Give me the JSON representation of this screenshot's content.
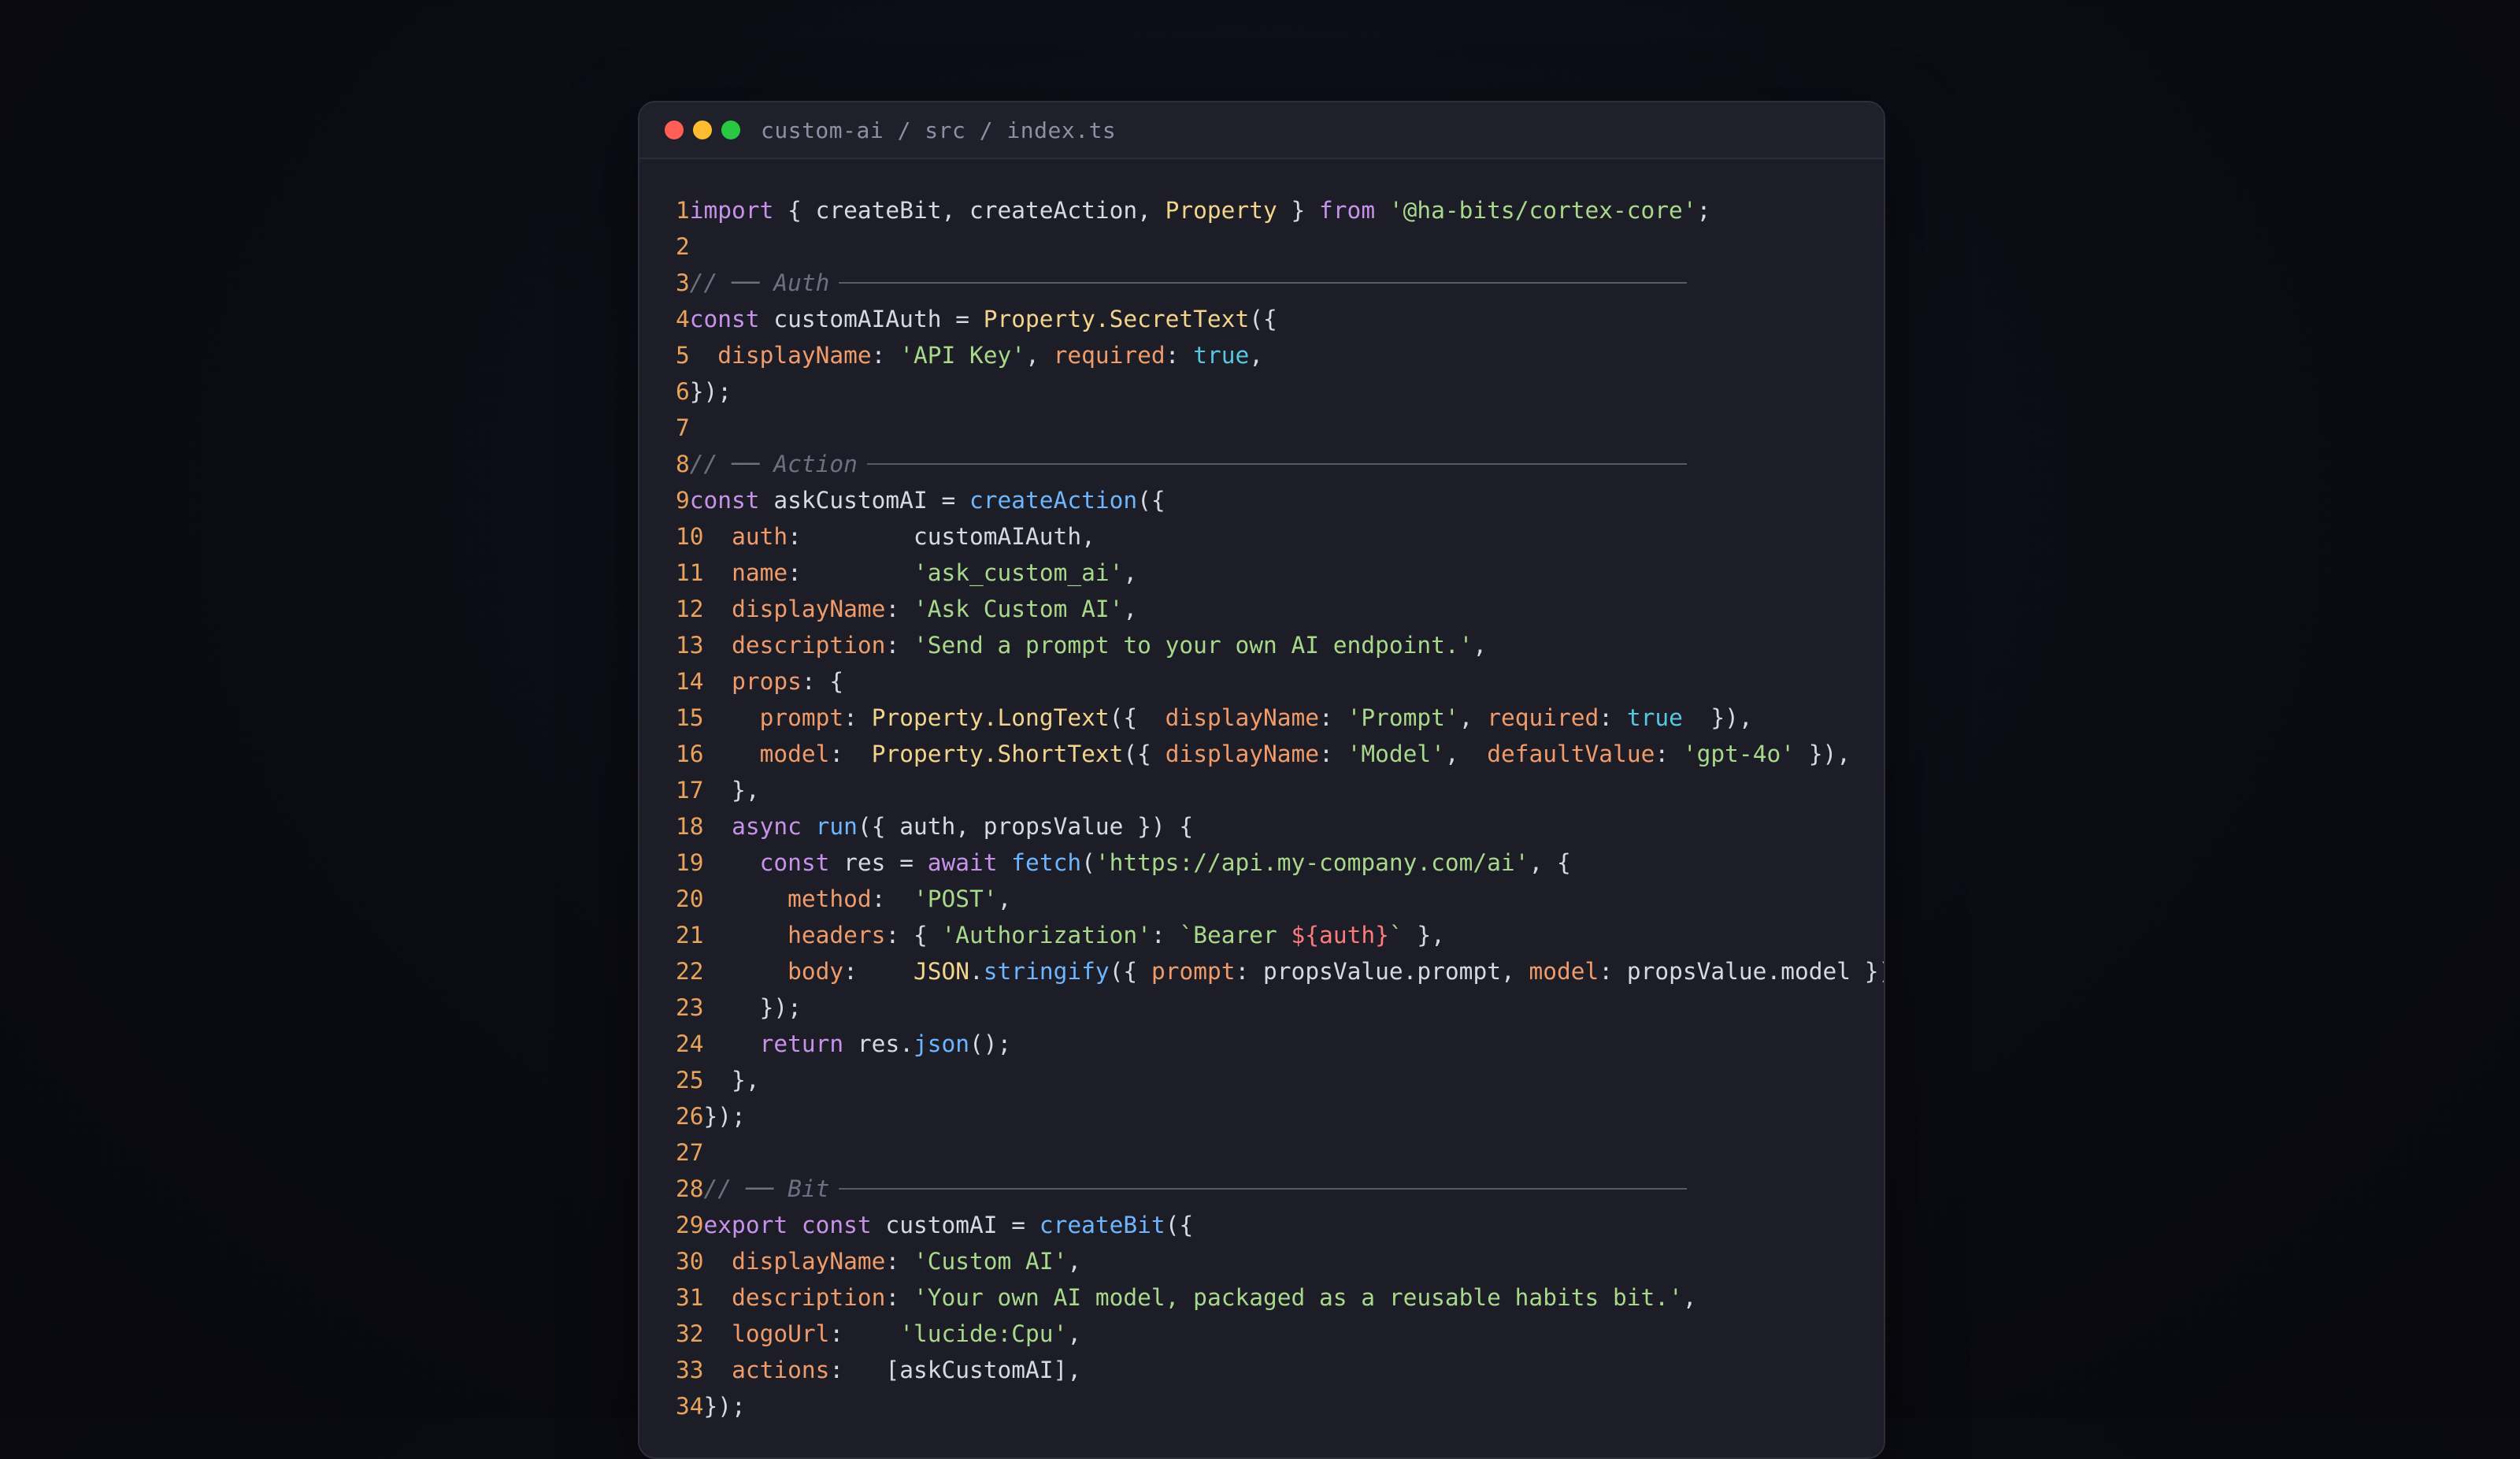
{
  "window": {
    "title": "custom-ai / src / index.ts",
    "controls": [
      {
        "name": "close",
        "color": "#ff5f57"
      },
      {
        "name": "minimize",
        "color": "#febc2e"
      },
      {
        "name": "maximize",
        "color": "#28c840"
      }
    ]
  },
  "colors": {
    "background": "#0b0b13",
    "window": "#1d1d27",
    "line_number": "#e8a25c",
    "keyword": "#c792ea",
    "string": "#a8d88a",
    "function": "#6cb6ff",
    "class": "#f2d48b",
    "property": "#ef9b6a",
    "boolean": "#56c7e0",
    "comment": "#6f6f82"
  },
  "code_lines": [
    {
      "n": "1",
      "tokens": [
        [
          "kw",
          "import"
        ],
        [
          "plain",
          " { createBit, createAction, "
        ],
        [
          "cls",
          "Property"
        ],
        [
          "plain",
          " } "
        ],
        [
          "kw",
          "from"
        ],
        [
          "plain",
          " "
        ],
        [
          "str",
          "'@ha-bits/cortex-core'"
        ],
        [
          "plain",
          ";"
        ]
      ]
    },
    {
      "n": "2",
      "tokens": []
    },
    {
      "n": "3",
      "tokens": [
        [
          "cmt",
          "// ── Auth"
        ]
      ],
      "rule": true
    },
    {
      "n": "4",
      "tokens": [
        [
          "kw",
          "const"
        ],
        [
          "plain",
          " customAIAuth = "
        ],
        [
          "cls",
          "Property.SecretText"
        ],
        [
          "plain",
          "({"
        ]
      ]
    },
    {
      "n": "5",
      "tokens": [
        [
          "plain",
          "  "
        ],
        [
          "prop",
          "displayName"
        ],
        [
          "plain",
          ": "
        ],
        [
          "str",
          "'API Key'"
        ],
        [
          "plain",
          ", "
        ],
        [
          "prop",
          "required"
        ],
        [
          "plain",
          ": "
        ],
        [
          "bool",
          "true"
        ],
        [
          "plain",
          ","
        ]
      ]
    },
    {
      "n": "6",
      "tokens": [
        [
          "plain",
          "});"
        ]
      ]
    },
    {
      "n": "7",
      "tokens": []
    },
    {
      "n": "8",
      "tokens": [
        [
          "cmt",
          "// ── Action"
        ]
      ],
      "rule": true
    },
    {
      "n": "9",
      "tokens": [
        [
          "kw",
          "const"
        ],
        [
          "plain",
          " askCustomAI = "
        ],
        [
          "fn",
          "createAction"
        ],
        [
          "plain",
          "({"
        ]
      ]
    },
    {
      "n": "10",
      "tokens": [
        [
          "plain",
          "  "
        ],
        [
          "prop",
          "auth"
        ],
        [
          "plain",
          ":        customAIAuth,"
        ]
      ]
    },
    {
      "n": "11",
      "tokens": [
        [
          "plain",
          "  "
        ],
        [
          "prop",
          "name"
        ],
        [
          "plain",
          ":        "
        ],
        [
          "str",
          "'ask_custom_ai'"
        ],
        [
          "plain",
          ","
        ]
      ]
    },
    {
      "n": "12",
      "tokens": [
        [
          "plain",
          "  "
        ],
        [
          "prop",
          "displayName"
        ],
        [
          "plain",
          ": "
        ],
        [
          "str",
          "'Ask Custom AI'"
        ],
        [
          "plain",
          ","
        ]
      ]
    },
    {
      "n": "13",
      "tokens": [
        [
          "plain",
          "  "
        ],
        [
          "prop",
          "description"
        ],
        [
          "plain",
          ": "
        ],
        [
          "str",
          "'Send a prompt to your own AI endpoint.'"
        ],
        [
          "plain",
          ","
        ]
      ]
    },
    {
      "n": "14",
      "tokens": [
        [
          "plain",
          "  "
        ],
        [
          "prop",
          "props"
        ],
        [
          "plain",
          ": {"
        ]
      ]
    },
    {
      "n": "15",
      "tokens": [
        [
          "plain",
          "    "
        ],
        [
          "prop",
          "prompt"
        ],
        [
          "plain",
          ": "
        ],
        [
          "cls",
          "Property.LongText"
        ],
        [
          "plain",
          "({  "
        ],
        [
          "prop",
          "displayName"
        ],
        [
          "plain",
          ": "
        ],
        [
          "str",
          "'Prompt'"
        ],
        [
          "plain",
          ", "
        ],
        [
          "prop",
          "required"
        ],
        [
          "plain",
          ": "
        ],
        [
          "bool",
          "true"
        ],
        [
          "plain",
          "  }),"
        ]
      ]
    },
    {
      "n": "16",
      "tokens": [
        [
          "plain",
          "    "
        ],
        [
          "prop",
          "model"
        ],
        [
          "plain",
          ":  "
        ],
        [
          "cls",
          "Property.ShortText"
        ],
        [
          "plain",
          "({ "
        ],
        [
          "prop",
          "displayName"
        ],
        [
          "plain",
          ": "
        ],
        [
          "str",
          "'Model'"
        ],
        [
          "plain",
          ",  "
        ],
        [
          "prop",
          "defaultValue"
        ],
        [
          "plain",
          ": "
        ],
        [
          "str",
          "'gpt-4o'"
        ],
        [
          "plain",
          " }),"
        ]
      ]
    },
    {
      "n": "17",
      "tokens": [
        [
          "plain",
          "  },"
        ]
      ]
    },
    {
      "n": "18",
      "tokens": [
        [
          "plain",
          "  "
        ],
        [
          "kw",
          "async"
        ],
        [
          "plain",
          " "
        ],
        [
          "fn",
          "run"
        ],
        [
          "plain",
          "({ auth, propsValue }) {"
        ]
      ]
    },
    {
      "n": "19",
      "tokens": [
        [
          "plain",
          "    "
        ],
        [
          "kw",
          "const"
        ],
        [
          "plain",
          " res = "
        ],
        [
          "kw",
          "await"
        ],
        [
          "plain",
          " "
        ],
        [
          "fn",
          "fetch"
        ],
        [
          "plain",
          "("
        ],
        [
          "str",
          "'https://api.my-company.com/ai'"
        ],
        [
          "plain",
          ", {"
        ]
      ]
    },
    {
      "n": "20",
      "tokens": [
        [
          "plain",
          "      "
        ],
        [
          "prop",
          "method"
        ],
        [
          "plain",
          ":  "
        ],
        [
          "str",
          "'POST'"
        ],
        [
          "plain",
          ","
        ]
      ]
    },
    {
      "n": "21",
      "tokens": [
        [
          "plain",
          "      "
        ],
        [
          "prop",
          "headers"
        ],
        [
          "plain",
          ": { "
        ],
        [
          "str",
          "'Authorization'"
        ],
        [
          "plain",
          ": "
        ],
        [
          "str",
          "`Bearer "
        ],
        [
          "interp",
          "${auth}"
        ],
        [
          "str",
          "`"
        ],
        [
          "plain",
          " },"
        ]
      ]
    },
    {
      "n": "22",
      "tokens": [
        [
          "plain",
          "      "
        ],
        [
          "prop",
          "body"
        ],
        [
          "plain",
          ":    "
        ],
        [
          "cls",
          "JSON"
        ],
        [
          "plain",
          "."
        ],
        [
          "fn",
          "stringify"
        ],
        [
          "plain",
          "({ "
        ],
        [
          "prop",
          "prompt"
        ],
        [
          "plain",
          ": propsValue.prompt, "
        ],
        [
          "prop",
          "model"
        ],
        [
          "plain",
          ": propsValue.model }),"
        ]
      ]
    },
    {
      "n": "23",
      "tokens": [
        [
          "plain",
          "    });"
        ]
      ]
    },
    {
      "n": "24",
      "tokens": [
        [
          "plain",
          "    "
        ],
        [
          "kw",
          "return"
        ],
        [
          "plain",
          " res."
        ],
        [
          "fn",
          "json"
        ],
        [
          "plain",
          "();"
        ]
      ]
    },
    {
      "n": "25",
      "tokens": [
        [
          "plain",
          "  },"
        ]
      ]
    },
    {
      "n": "26",
      "tokens": [
        [
          "plain",
          "});"
        ]
      ]
    },
    {
      "n": "27",
      "tokens": []
    },
    {
      "n": "28",
      "tokens": [
        [
          "cmt",
          "// ── Bit"
        ]
      ],
      "rule": true
    },
    {
      "n": "29",
      "tokens": [
        [
          "kw",
          "export"
        ],
        [
          "plain",
          " "
        ],
        [
          "kw",
          "const"
        ],
        [
          "plain",
          " customAI = "
        ],
        [
          "fn",
          "createBit"
        ],
        [
          "plain",
          "({"
        ]
      ]
    },
    {
      "n": "30",
      "tokens": [
        [
          "plain",
          "  "
        ],
        [
          "prop",
          "displayName"
        ],
        [
          "plain",
          ": "
        ],
        [
          "str",
          "'Custom AI'"
        ],
        [
          "plain",
          ","
        ]
      ]
    },
    {
      "n": "31",
      "tokens": [
        [
          "plain",
          "  "
        ],
        [
          "prop",
          "description"
        ],
        [
          "plain",
          ": "
        ],
        [
          "str",
          "'Your own AI model, packaged as a reusable habits bit.'"
        ],
        [
          "plain",
          ","
        ]
      ]
    },
    {
      "n": "32",
      "tokens": [
        [
          "plain",
          "  "
        ],
        [
          "prop",
          "logoUrl"
        ],
        [
          "plain",
          ":    "
        ],
        [
          "str",
          "'lucide:Cpu'"
        ],
        [
          "plain",
          ","
        ]
      ]
    },
    {
      "n": "33",
      "tokens": [
        [
          "plain",
          "  "
        ],
        [
          "prop",
          "actions"
        ],
        [
          "plain",
          ":   [askCustomAI],"
        ]
      ]
    },
    {
      "n": "34",
      "tokens": [
        [
          "plain",
          "});"
        ]
      ]
    }
  ]
}
